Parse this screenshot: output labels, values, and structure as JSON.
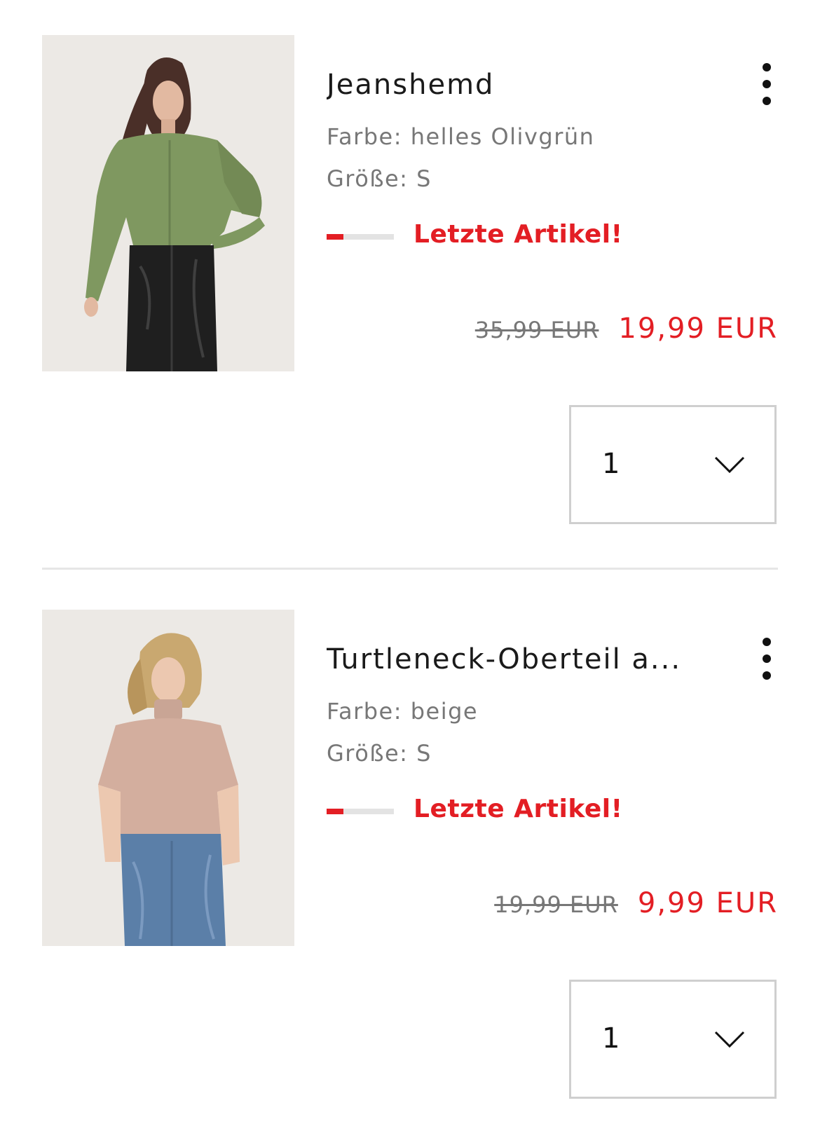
{
  "items": [
    {
      "title": "Jeanshemd",
      "color_text": "Farbe: helles Olivgrün",
      "size_text": "Größe: S",
      "stock_text": "Letzte Artikel!",
      "stock_level": 0.25,
      "old_price": "35,99 EUR",
      "new_price": "19,99 EUR",
      "quantity": "1",
      "image_alt": "model in olive green shirt and black leather skirt"
    },
    {
      "title": "Turtleneck-Oberteil a...",
      "color_text": "Farbe: beige",
      "size_text": "Größe: S",
      "stock_text": "Letzte Artikel!",
      "stock_level": 0.25,
      "old_price": "19,99 EUR",
      "new_price": "9,99 EUR",
      "quantity": "1",
      "image_alt": "model in beige turtleneck top and blue jeans"
    }
  ],
  "colors": {
    "accent": "#e31e24",
    "muted_text": "#777777",
    "border": "#cfcfcf"
  },
  "icons": {
    "menu": "more-vertical-icon",
    "dropdown": "chevron-down-icon"
  }
}
